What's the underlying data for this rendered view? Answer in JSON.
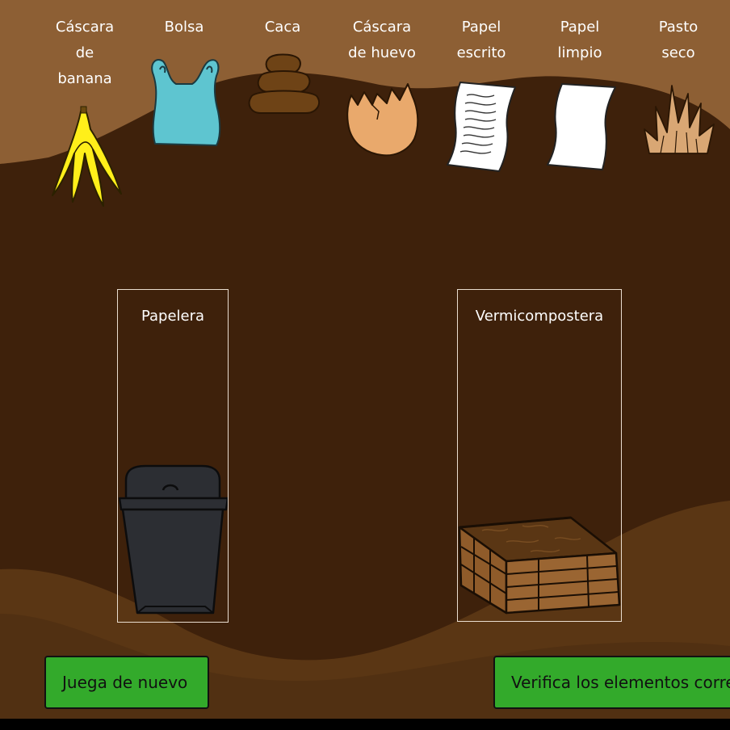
{
  "items": [
    {
      "label": "Cáscara\nde\nbanana",
      "icon": "banana-peel-icon"
    },
    {
      "label": "Bolsa",
      "icon": "plastic-bag-icon"
    },
    {
      "label": "Caca",
      "icon": "poop-icon"
    },
    {
      "label": "Cáscara\nde huevo",
      "icon": "eggshell-icon"
    },
    {
      "label": "Papel\nescrito",
      "icon": "written-paper-icon"
    },
    {
      "label": "Papel\nlimpio",
      "icon": "blank-paper-icon"
    },
    {
      "label": "Pasto\nseco",
      "icon": "dry-grass-icon"
    }
  ],
  "bins": {
    "trash": {
      "label": "Papelera",
      "icon": "trash-can-icon"
    },
    "compost": {
      "label": "Vermicompostera",
      "icon": "compost-crate-icon"
    }
  },
  "buttons": {
    "replay": "Juega de nuevo",
    "verify": "Verifica los elementos correctos"
  },
  "colors": {
    "ground_dark": "#3e210b",
    "ground_light": "#8d5f34",
    "ground_mid": "#5a3614",
    "button_green": "#33aa2b"
  }
}
